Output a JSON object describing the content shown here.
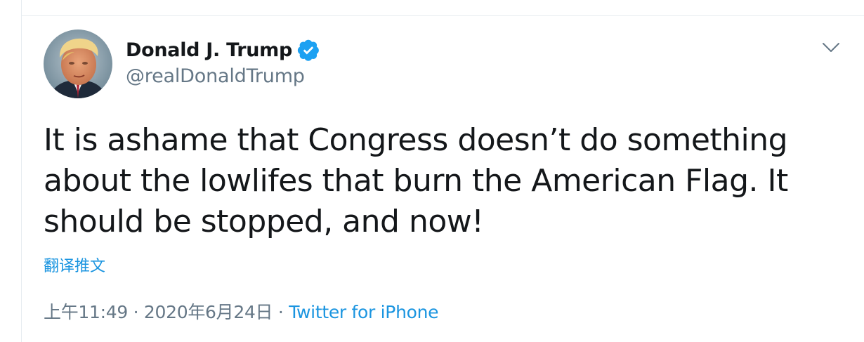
{
  "tweet": {
    "author": {
      "display_name": "Donald J. Trump",
      "handle": "@realDonaldTrump",
      "verified": true
    },
    "text": "It is ashame that Congress doesn’t do something about the lowlifes that burn the American Flag. It should be stopped, and now!",
    "translate_label": "翻译推文",
    "time": "上午11:49",
    "separator": "·",
    "date": "2020年6月24日",
    "source": "Twitter for iPhone"
  },
  "icons": {
    "verified": "verified-badge-icon",
    "more": "chevron-down-icon"
  },
  "colors": {
    "text_primary": "#14171a",
    "text_secondary": "#657786",
    "link": "#1b95e0",
    "verified": "#1da1f2",
    "border": "#e6ecf0"
  }
}
